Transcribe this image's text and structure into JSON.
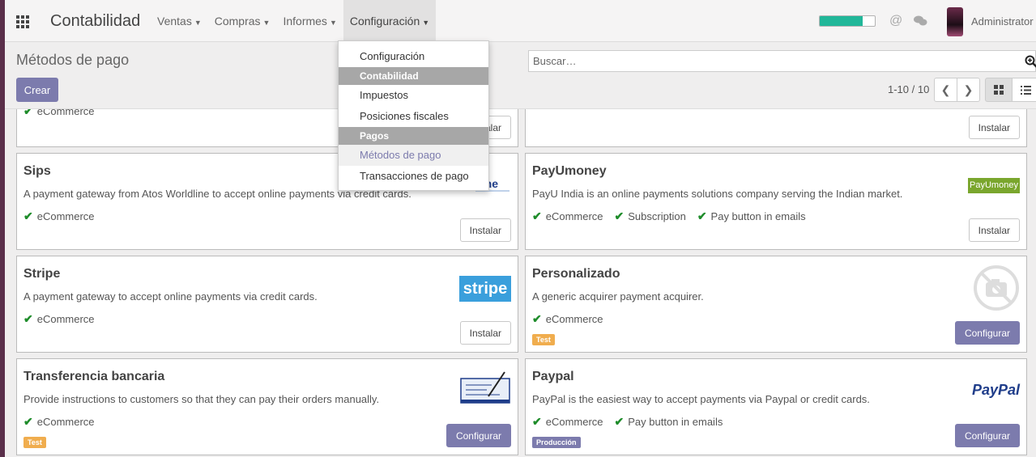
{
  "app": {
    "brand": "Contabilidad",
    "menu": [
      {
        "label": "Ventas"
      },
      {
        "label": "Compras"
      },
      {
        "label": "Informes"
      },
      {
        "label": "Configuración"
      }
    ],
    "user": "Administrator",
    "progress": 0.78
  },
  "dropdown": {
    "items": [
      {
        "type": "item",
        "label": "Configuración"
      },
      {
        "type": "header",
        "label": "Contabilidad"
      },
      {
        "type": "item",
        "label": "Impuestos"
      },
      {
        "type": "item",
        "label": "Posiciones fiscales"
      },
      {
        "type": "header",
        "label": "Pagos"
      },
      {
        "type": "item",
        "label": "Métodos de pago",
        "active": true
      },
      {
        "type": "item",
        "label": "Transacciones de pago"
      }
    ]
  },
  "control_panel": {
    "title": "Métodos de pago",
    "create_label": "Crear",
    "search_placeholder": "Buscar…",
    "pager": "1-10 / 10"
  },
  "cards": [
    {
      "title": "",
      "desc": "",
      "features": [
        "eCommerce"
      ],
      "button": "Instalar",
      "badge": "",
      "logo": ""
    },
    {
      "title": "",
      "desc": "",
      "features": [],
      "button": "Instalar",
      "badge": "",
      "logo": ""
    },
    {
      "title": "Sips",
      "desc": "A payment gateway from Atos Worldline to accept online payments via credit cards.",
      "features": [
        "eCommerce"
      ],
      "button": "Instalar",
      "badge": "",
      "logo": "worldline"
    },
    {
      "title": "PayUmoney",
      "desc": "PayU India is an online payments solutions company serving the Indian market.",
      "features": [
        "eCommerce",
        "Subscription",
        "Pay button in emails"
      ],
      "button": "Instalar",
      "badge": "",
      "logo": "payumoney",
      "logo_text": "PayUmoney"
    },
    {
      "title": "Stripe",
      "desc": "A payment gateway to accept online payments via credit cards.",
      "features": [
        "eCommerce"
      ],
      "button": "Instalar",
      "badge": "",
      "logo": "stripe",
      "logo_text": "stripe"
    },
    {
      "title": "Personalizado",
      "desc": "A generic acquirer payment acquirer.",
      "features": [
        "eCommerce"
      ],
      "button": "Configurar",
      "badge": "Test",
      "logo": "no-image"
    },
    {
      "title": "Transferencia bancaria",
      "desc": "Provide instructions to customers so that they can pay their orders manually.",
      "features": [
        "eCommerce"
      ],
      "button": "Configurar",
      "badge": "Test",
      "logo": "cheque"
    },
    {
      "title": "Paypal",
      "desc": "PayPal is the easiest way to accept payments via Paypal or credit cards.",
      "features": [
        "eCommerce",
        "Pay button in emails"
      ],
      "button": "Configurar",
      "badge": "Producción",
      "logo": "paypal",
      "logo_text": "PayPal"
    }
  ],
  "colors": {
    "primary": "#7c7bad",
    "check": "#1e8c2a",
    "test_badge": "#f0ad4e",
    "progress": "#21b799"
  }
}
